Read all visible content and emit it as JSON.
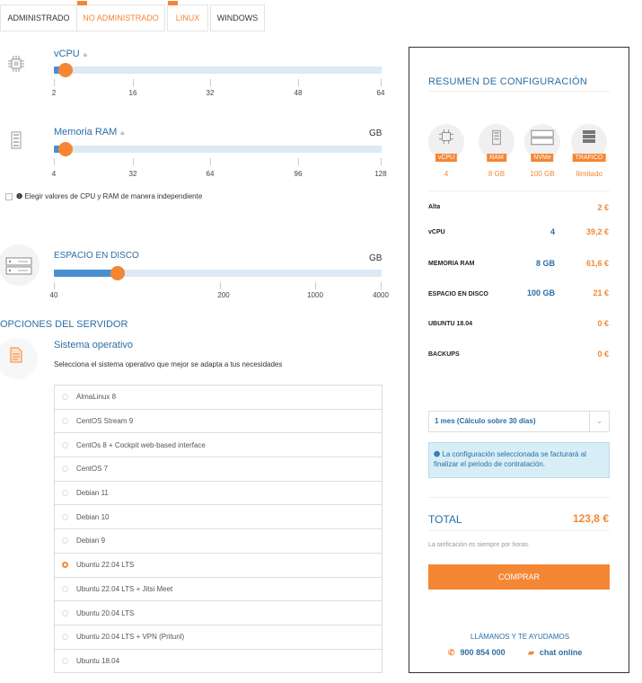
{
  "tabs": [
    {
      "label": "ADMINISTRADO",
      "active": false
    },
    {
      "label": "NO ADMINISTRADO",
      "active": true
    },
    {
      "label": "LINUX",
      "active": true
    },
    {
      "label": "WINDOWS",
      "active": false
    }
  ],
  "vcpu": {
    "title": "vCPU",
    "value": 4,
    "ticks": [
      "2",
      "16",
      "32",
      "48",
      "64"
    ]
  },
  "ram": {
    "title": "Memoria RAM",
    "unit": "GB",
    "value": 8,
    "ticks": [
      "4",
      "32",
      "64",
      "96",
      "128"
    ]
  },
  "independent": {
    "label": "Elegir valores de CPU y RAM de manera independiente",
    "checked": false
  },
  "disk": {
    "title": "ESPACIO EN DISCO",
    "unit": "GB",
    "value": 100,
    "ticks": [
      "40",
      "200",
      "1000",
      "4000"
    ]
  },
  "server_options": {
    "title": "OPCIONES DEL SERVIDOR",
    "os_title": "Sistema operativo",
    "os_subtitle": "Selecciona el sistema operativo que mejor se adapta a tus necesidades",
    "os_list": [
      {
        "label": "AlmaLinux 8",
        "selected": false
      },
      {
        "label": "CentOS Stream 9",
        "selected": false
      },
      {
        "label": "CentOs 8 + Cockpit web-based interface",
        "selected": false
      },
      {
        "label": "CentOS 7",
        "selected": false
      },
      {
        "label": "Debian 11",
        "selected": false
      },
      {
        "label": "Debian 10",
        "selected": false
      },
      {
        "label": "Debian 9",
        "selected": false
      },
      {
        "label": "Ubuntu 22.04 LTS",
        "selected": true
      },
      {
        "label": "Ubuntu 22.04 LTS + Jitsi Meet",
        "selected": false
      },
      {
        "label": "Ubuntu 20.04 LTS",
        "selected": false
      },
      {
        "label": "Ubuntu 20.04 LTS + VPN (Pritunl)",
        "selected": false
      },
      {
        "label": "Ubuntu 18.04",
        "selected": false
      }
    ]
  },
  "summary": {
    "title": "RESUMEN DE CONFIGURACIÓN",
    "badges": [
      {
        "badge": "vCPU",
        "value": "4",
        "icon": "cpu-icon"
      },
      {
        "badge": "RAM",
        "value": "8 GB",
        "icon": "ram-icon"
      },
      {
        "badge": "NVMe",
        "value": "100 GB",
        "icon": "disk-icon"
      },
      {
        "badge": "TRÁFICO",
        "value": "Ilimitado",
        "icon": "server-icon"
      }
    ],
    "rows": [
      {
        "label": "Alta",
        "mid": "",
        "price": "2 €"
      },
      {
        "label": "vCPU",
        "mid": "4",
        "price": "39,2 €"
      },
      {
        "label": "MEMORIA RAM",
        "mid": "8 GB",
        "price": "61,6 €"
      },
      {
        "label": "ESPACIO EN DISCO",
        "mid": "100 GB",
        "price": "21 €"
      },
      {
        "label": "UBUNTU 18.04",
        "mid": "",
        "price": "0 €"
      },
      {
        "label": "BACKUPS",
        "mid": "",
        "price": "0 €"
      }
    ],
    "period": "1 mes (Cálculo sobre 30 días)",
    "info": "La configuración seleccionada se facturará al finalizar el periodo de contratación.",
    "total_label": "TOTAL",
    "total_value": "123,8 €",
    "note": "La tarificación es siempre por horas.",
    "buy_label": "COMPRAR",
    "call_title": "LLÁMANOS Y TE AYUDAMOS",
    "phone": "900 854 000",
    "chat": "chat online"
  },
  "colors": {
    "accent": "#f58634",
    "blue": "#2a6ea6",
    "track": "#dde9f4",
    "fill": "#4a8fd1"
  }
}
